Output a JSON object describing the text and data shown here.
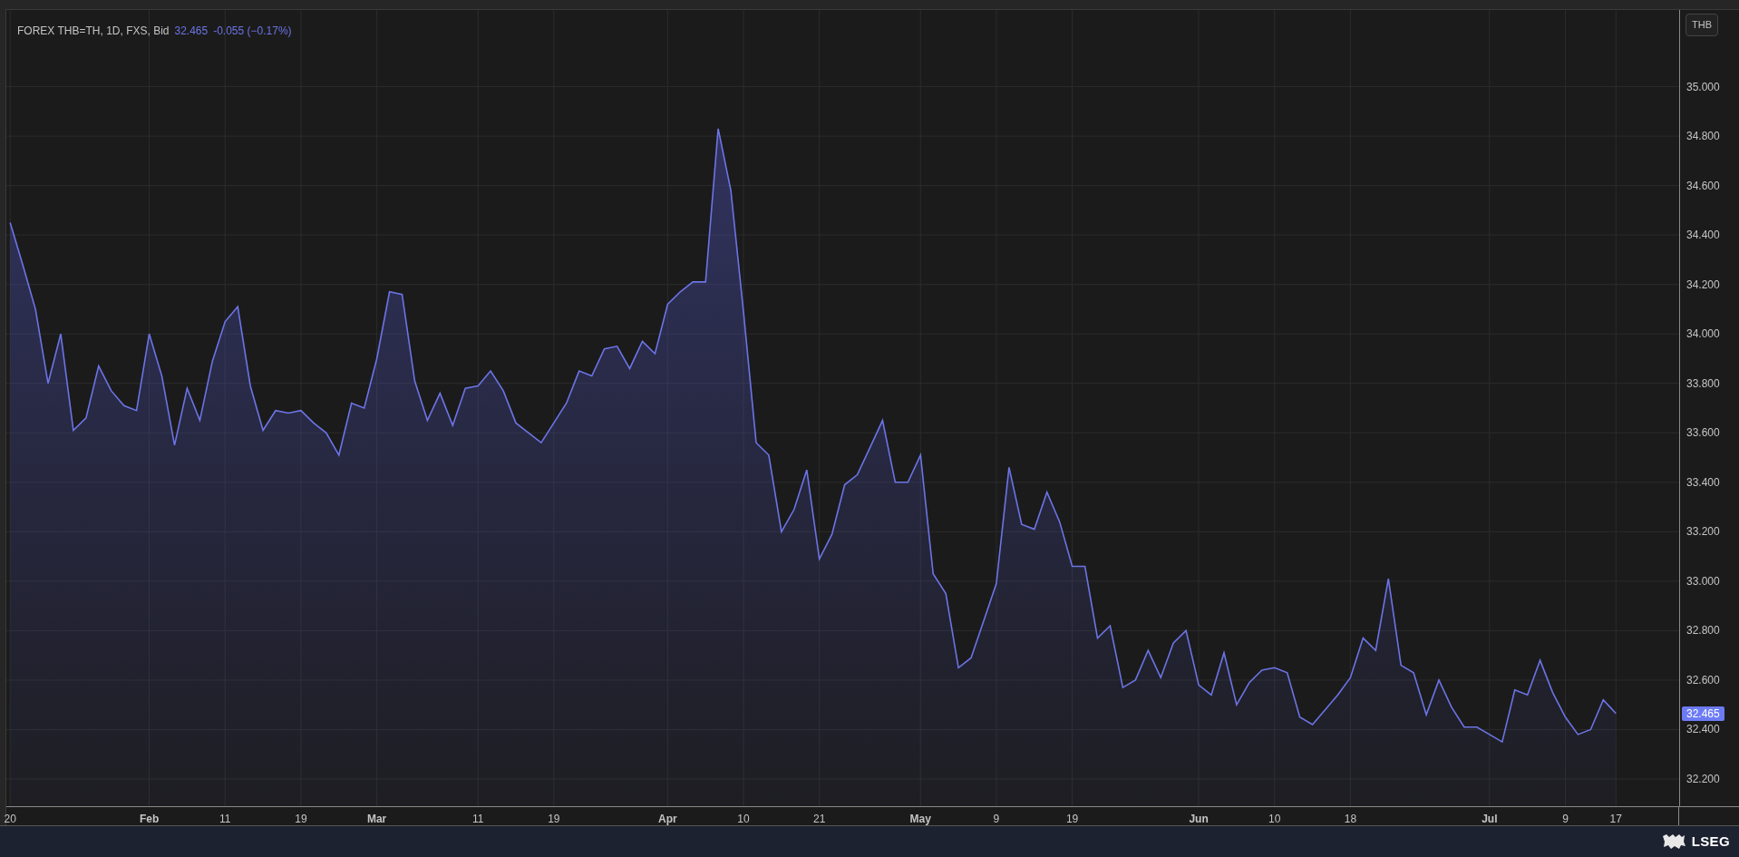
{
  "header": {
    "symbol": "FOREX THB=TH, 1D, FXS, Bid",
    "last": "32.465",
    "change": "-0.055 (−0.17%)"
  },
  "currency_button": "THB",
  "chart_data": {
    "type": "area",
    "categories": [
      "20",
      null,
      null,
      null,
      null,
      null,
      null,
      null,
      null,
      null,
      null,
      "Feb",
      null,
      null,
      null,
      null,
      null,
      "11",
      null,
      null,
      null,
      null,
      null,
      "19",
      null,
      null,
      null,
      null,
      null,
      "Mar",
      null,
      null,
      null,
      null,
      null,
      null,
      null,
      "11",
      null,
      null,
      null,
      null,
      null,
      "19",
      null,
      null,
      null,
      null,
      null,
      null,
      null,
      null,
      "Apr",
      null,
      null,
      null,
      null,
      null,
      "10",
      null,
      null,
      null,
      null,
      null,
      "21",
      null,
      null,
      null,
      null,
      null,
      null,
      null,
      "May",
      null,
      null,
      null,
      null,
      null,
      "9",
      null,
      null,
      null,
      null,
      null,
      "19",
      null,
      null,
      null,
      null,
      null,
      null,
      null,
      null,
      null,
      "Jun",
      null,
      null,
      null,
      null,
      null,
      "10",
      null,
      null,
      null,
      null,
      null,
      "18",
      null,
      null,
      null,
      null,
      null,
      null,
      null,
      null,
      null,
      null,
      "Jul",
      null,
      null,
      null,
      null,
      null,
      "9",
      null,
      null,
      null,
      "17"
    ],
    "series": [
      {
        "color": "#6c74e6",
        "values": [
          34.45,
          34.28,
          34.1,
          33.8,
          34.0,
          33.61,
          33.66,
          33.87,
          33.77,
          33.71,
          33.69,
          34.0,
          33.83,
          33.55,
          33.78,
          33.65,
          33.89,
          34.05,
          34.11,
          33.79,
          33.61,
          33.69,
          33.68,
          33.69,
          33.64,
          33.6,
          33.51,
          33.72,
          33.7,
          33.9,
          34.17,
          34.16,
          33.81,
          33.65,
          33.76,
          33.63,
          33.78,
          33.79,
          33.85,
          33.77,
          33.64,
          33.6,
          33.56,
          33.64,
          33.72,
          33.85,
          33.83,
          33.94,
          33.95,
          33.86,
          33.97,
          33.92,
          34.12,
          34.17,
          34.21,
          34.21,
          34.83,
          34.58,
          34.09,
          33.56,
          33.51,
          33.2,
          33.29,
          33.45,
          33.09,
          33.19,
          33.39,
          33.43,
          33.54,
          33.65,
          33.4,
          33.4,
          33.51,
          33.03,
          32.95,
          32.65,
          32.69,
          32.84,
          32.99,
          33.46,
          33.23,
          33.21,
          33.36,
          33.24,
          33.06,
          33.06,
          32.77,
          32.82,
          32.57,
          32.6,
          32.72,
          32.61,
          32.75,
          32.8,
          32.58,
          32.54,
          32.71,
          32.5,
          32.59,
          32.64,
          32.65,
          32.63,
          32.45,
          32.42,
          32.48,
          32.54,
          32.61,
          32.77,
          32.72,
          33.01,
          32.66,
          32.63,
          32.46,
          32.6,
          32.49,
          32.41,
          32.41,
          32.38,
          32.35,
          32.56,
          32.54,
          32.68,
          32.55,
          32.45,
          32.38,
          32.4,
          32.52,
          32.465
        ]
      }
    ],
    "ylim": [
      32.09,
      35.31
    ],
    "grid": true,
    "yticks": [
      {
        "value": 32.2,
        "label": "32.200"
      },
      {
        "value": 32.4,
        "label": "32.400"
      },
      {
        "value": 32.6,
        "label": "32.600"
      },
      {
        "value": 32.8,
        "label": "32.800"
      },
      {
        "value": 33.0,
        "label": "33.000"
      },
      {
        "value": 33.2,
        "label": "33.200"
      },
      {
        "value": 33.4,
        "label": "33.400"
      },
      {
        "value": 33.6,
        "label": "33.600"
      },
      {
        "value": 33.8,
        "label": "33.800"
      },
      {
        "value": 34.0,
        "label": "34.000"
      },
      {
        "value": 34.2,
        "label": "34.200"
      },
      {
        "value": 34.4,
        "label": "34.400"
      },
      {
        "value": 34.6,
        "label": "34.600"
      },
      {
        "value": 34.8,
        "label": "34.800"
      },
      {
        "value": 35.0,
        "label": "35.000"
      }
    ]
  },
  "last_price_label": "32.465",
  "footer": {
    "logo": "LSEG"
  }
}
